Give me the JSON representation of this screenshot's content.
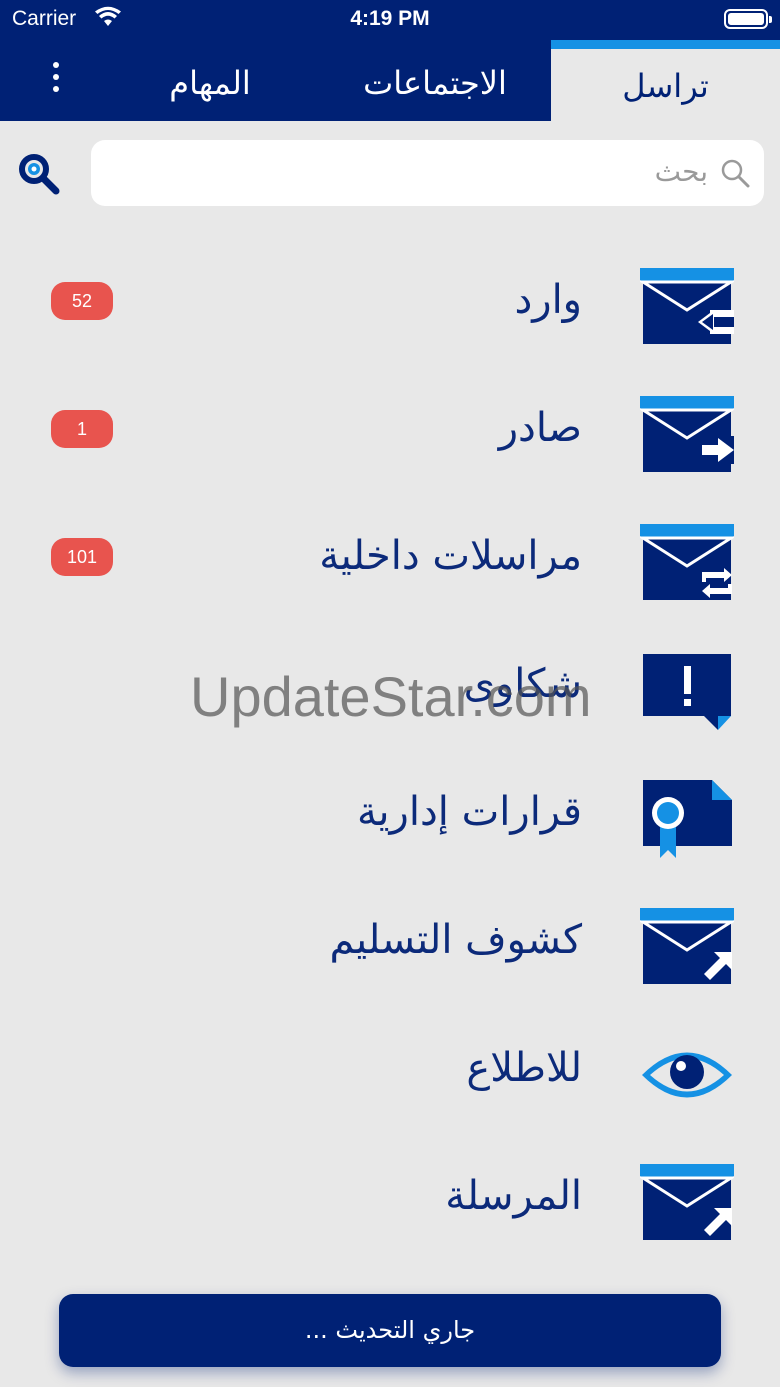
{
  "status_bar": {
    "carrier": "Carrier",
    "time": "4:19 PM"
  },
  "tabs": [
    {
      "label": "تراسل",
      "active": true
    },
    {
      "label": "الاجتماعات",
      "active": false
    },
    {
      "label": "المهام",
      "active": false
    }
  ],
  "search": {
    "placeholder": "بحث"
  },
  "menu": [
    {
      "label": "وارد",
      "icon": "mail-inbox-icon",
      "badge": "52"
    },
    {
      "label": "صادر",
      "icon": "mail-outbox-icon",
      "badge": "1"
    },
    {
      "label": "مراسلات داخلية",
      "icon": "mail-internal-icon",
      "badge": "101"
    },
    {
      "label": "شكاوى",
      "icon": "complaint-icon",
      "badge": null
    },
    {
      "label": "قرارات إدارية",
      "icon": "certificate-icon",
      "badge": null
    },
    {
      "label": "كشوف التسليم",
      "icon": "mail-delivery-icon",
      "badge": null
    },
    {
      "label": "للاطلاع",
      "icon": "eye-icon",
      "badge": null
    },
    {
      "label": "المرسلة",
      "icon": "mail-sent-icon",
      "badge": null
    }
  ],
  "watermark": "UpdateStar.com",
  "footer": {
    "status_text": "جاري التحديث ..."
  },
  "colors": {
    "primary": "#002175",
    "accent": "#1591e4",
    "badge": "#e8544e",
    "background": "#e8e8e8"
  }
}
